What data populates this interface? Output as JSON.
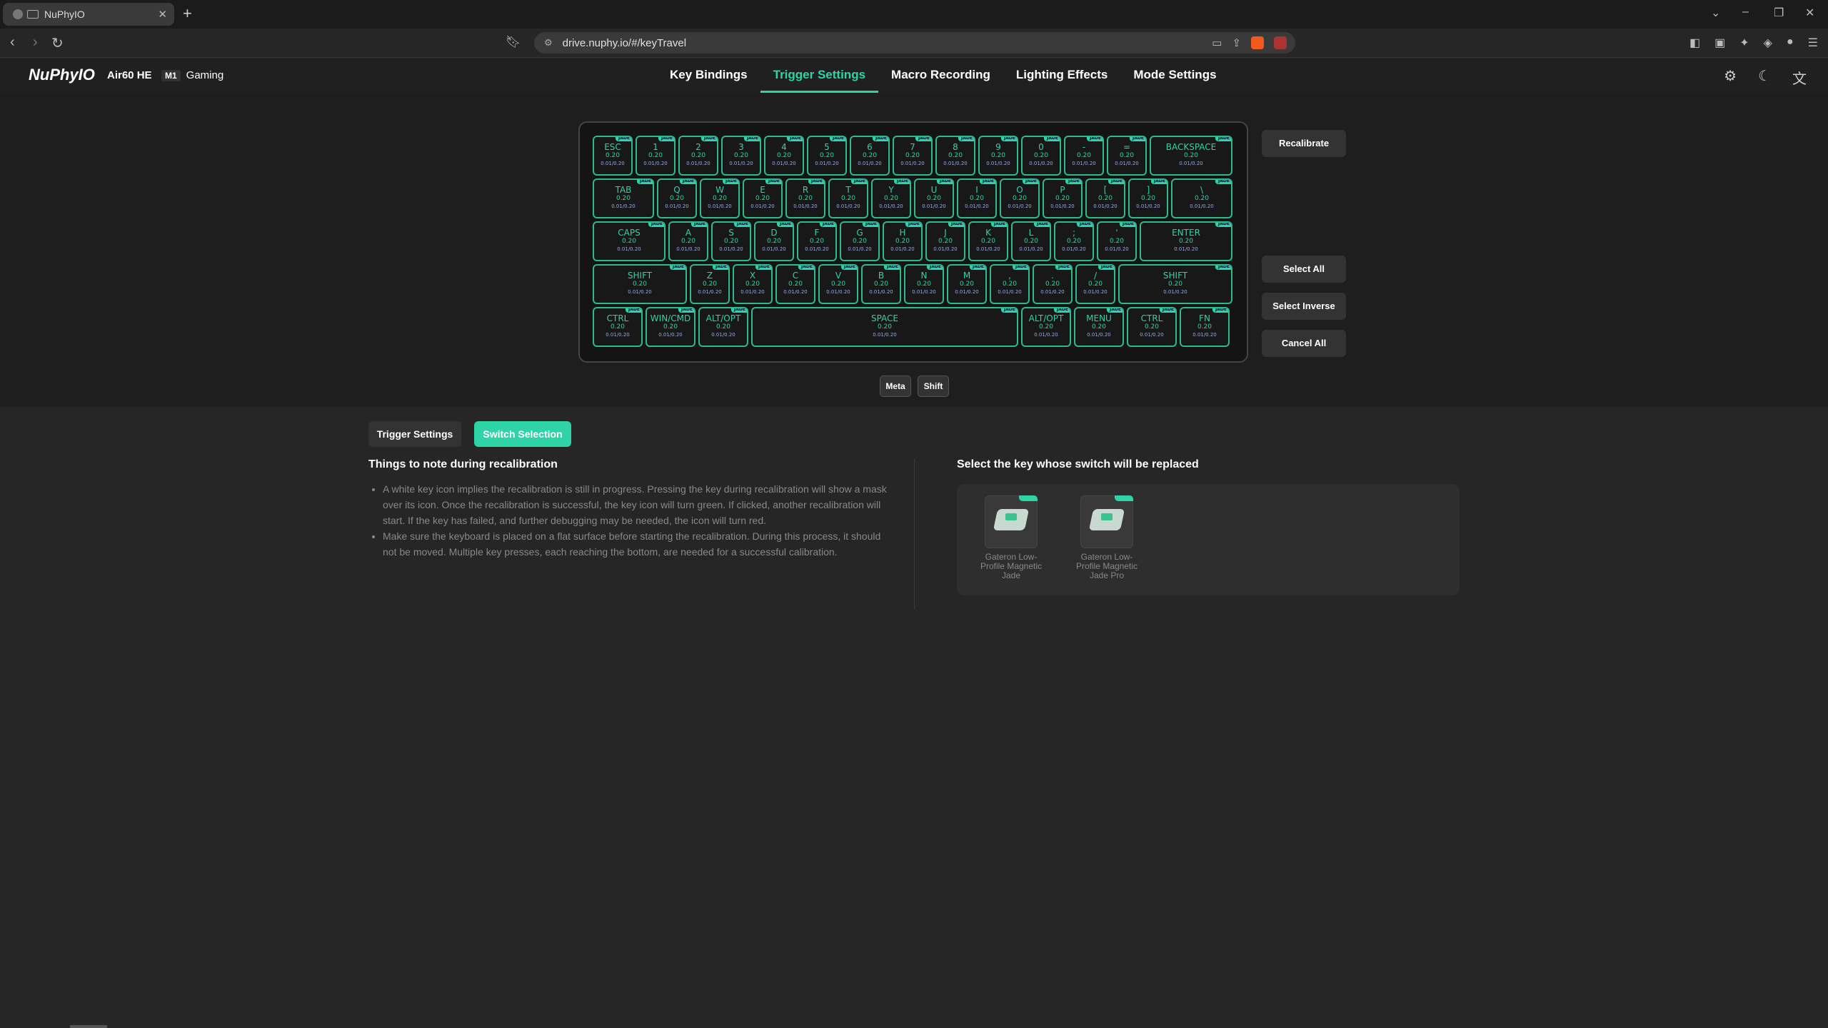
{
  "browser": {
    "tab_title": "NuPhyIO",
    "url": "drive.nuphy.io/#/keyTravel"
  },
  "app": {
    "logo": "NuPhyIO",
    "model": "Air60 HE",
    "mode_badge": "M1",
    "mode_name": "Gaming",
    "nav_tabs": [
      "Key Bindings",
      "Trigger Settings",
      "Macro Recording",
      "Lighting Effects",
      "Mode Settings"
    ],
    "active_tab": "Trigger Settings"
  },
  "keyboard": {
    "accent_color": "#2fd4a6",
    "key_value": "0.20",
    "key_range": "0.01/0.20",
    "switch_tag": "JADE",
    "rows": [
      [
        "ESC",
        "1",
        "2",
        "3",
        "4",
        "5",
        "6",
        "7",
        "8",
        "9",
        "0",
        "-",
        "=",
        "BACKSPACE"
      ],
      [
        "TAB",
        "Q",
        "W",
        "E",
        "R",
        "T",
        "Y",
        "U",
        "I",
        "O",
        "P",
        "[",
        "]",
        "\\"
      ],
      [
        "CAPS",
        "A",
        "S",
        "D",
        "F",
        "G",
        "H",
        "J",
        "K",
        "L",
        ";",
        "'",
        "ENTER"
      ],
      [
        "SHIFT",
        "Z",
        "X",
        "C",
        "V",
        "B",
        "N",
        "M",
        ",",
        ".",
        "/",
        "SHIFT"
      ],
      [
        "CTRL",
        "WIN/CMD",
        "ALT/OPT",
        "SPACE",
        "ALT/OPT",
        "MENU",
        "CTRL",
        "FN"
      ]
    ]
  },
  "side_buttons": {
    "recalibrate": "Recalibrate",
    "select_all": "Select All",
    "select_inverse": "Select Inverse",
    "cancel_all": "Cancel All"
  },
  "modifiers": {
    "meta": "Meta",
    "shift": "Shift"
  },
  "sub_tabs": {
    "trigger": "Trigger Settings",
    "switch": "Switch Selection",
    "active": "Switch Selection"
  },
  "notes": {
    "title": "Things to note during recalibration",
    "items": [
      "A white key icon implies the recalibration is still in progress. Pressing the key during recalibration will show a mask over its icon. Once the recalibration is successful, the key icon will turn green. If clicked, another recalibration will start. If the key has failed, and further debugging may be needed, the icon will turn red.",
      "Make sure the keyboard is placed on a flat surface before starting the recalibration. During this process, it should not be moved. Multiple key presses, each reaching the bottom, are needed for a successful calibration."
    ]
  },
  "switch_select": {
    "title": "Select the key whose switch will be replaced",
    "switches": [
      "Gateron Low-Profile Magnetic Jade",
      "Gateron Low-Profile Magnetic Jade Pro"
    ]
  }
}
